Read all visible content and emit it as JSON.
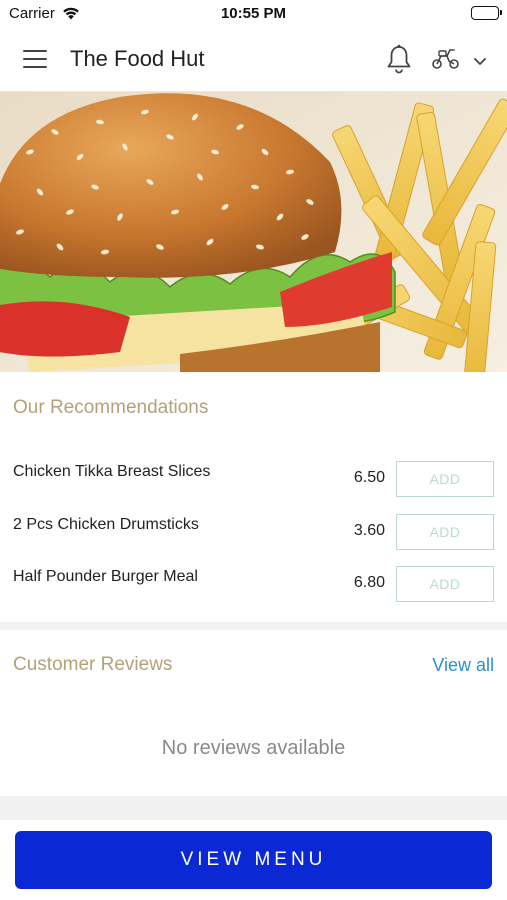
{
  "status_bar": {
    "carrier": "Carrier",
    "time": "10:55 PM",
    "icons": [
      "wifi-icon",
      "battery-icon"
    ]
  },
  "header": {
    "title": "The Food Hut",
    "icons": [
      "hamburger-menu-icon",
      "bell-icon",
      "scooter-icon",
      "chevron-down-icon"
    ]
  },
  "recommendations": {
    "title": "Our Recommendations",
    "items": [
      {
        "name": "Chicken Tikka Breast Slices",
        "price": "6.50",
        "add_label": "ADD"
      },
      {
        "name": "2 Pcs Chicken Drumsticks",
        "price": "3.60",
        "add_label": "ADD"
      },
      {
        "name": "Half Pounder Burger Meal",
        "price": "6.80",
        "add_label": "ADD"
      }
    ]
  },
  "reviews": {
    "title": "Customer Reviews",
    "view_all": "View all",
    "empty_text": "No reviews available"
  },
  "footer": {
    "view_menu": "VIEW MENU"
  },
  "colors": {
    "accent_blue": "#0a28d3",
    "section_title": "#b3a17c",
    "link": "#2b8fd0",
    "add_button": "#b9dcc9"
  }
}
